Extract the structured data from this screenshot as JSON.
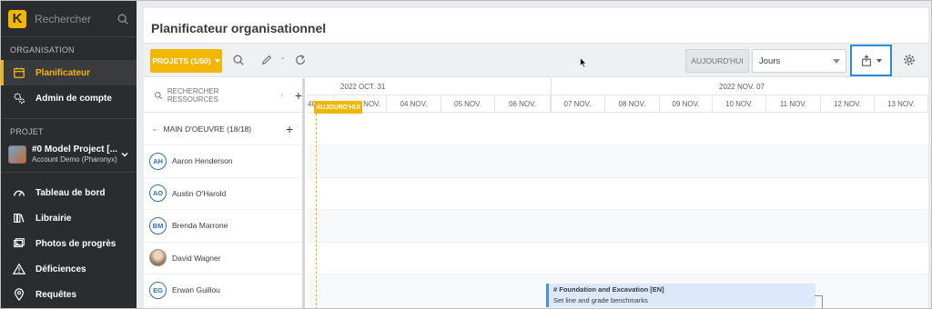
{
  "sidebar": {
    "logo_letter": "K",
    "search_placeholder": "Rechercher",
    "section_organisation": "ORGANISATION",
    "org_items": [
      {
        "label": "Planificateur",
        "icon": "calendar-icon",
        "active": true
      },
      {
        "label": "Admin de compte",
        "icon": "gears-icon",
        "active": false
      }
    ],
    "section_projet": "PROJET",
    "project": {
      "name": "#0 Model Project [...",
      "account": "Account Demo (Pharonyx)"
    },
    "project_items": [
      {
        "label": "Tableau de bord",
        "icon": "dashboard-icon"
      },
      {
        "label": "Librairie",
        "icon": "library-icon"
      },
      {
        "label": "Photos de progrès",
        "icon": "photos-icon"
      },
      {
        "label": "Déficiences",
        "icon": "warning-icon"
      },
      {
        "label": "Requêtes",
        "icon": "pin-icon"
      }
    ]
  },
  "main": {
    "title": "Planificateur organisationnel",
    "toolbar": {
      "projects_button": "PROJETS (1/50)",
      "today_button": "AUJOURD'HUI",
      "view_select": "Jours",
      "separator": "-"
    },
    "resources": {
      "search_label": "RECHERCHER RESSOURCES",
      "group_label": "MAIN D'OEUVRE (18/18)",
      "people": [
        {
          "initials": "AH",
          "name": "Aaron Henderson",
          "photo": false
        },
        {
          "initials": "AO",
          "name": "Austin O'Harold",
          "photo": false
        },
        {
          "initials": "BM",
          "name": "Brenda Marrone",
          "photo": false
        },
        {
          "initials": "DW",
          "name": "David Wagner",
          "photo": true
        },
        {
          "initials": "EG",
          "name": "Erwan Guillou",
          "photo": false
        }
      ]
    },
    "timeline": {
      "weeks": [
        "2022 OCT. 31",
        "2022 NOV. 07"
      ],
      "days": [
        "NOV.",
        "04 NOV.",
        "05 NOV.",
        "06 NOV.",
        "07 NOV.",
        "08 NOV.",
        "09 NOV.",
        "10 NOV.",
        "11 NOV.",
        "12 NOV.",
        "13 NOV."
      ],
      "first_day_fragment": "4O",
      "today_marker": "AUJOURD'HUI"
    },
    "task": {
      "title": "# Foundation and Excavation [EN]",
      "subtitle": "Set line and grade benchmarks"
    }
  },
  "colors": {
    "accent": "#f2b705",
    "sidebar_bg": "#2b2c2e",
    "export_border": "#2a8bd8",
    "avatar_blue": "#2f6fb0"
  }
}
